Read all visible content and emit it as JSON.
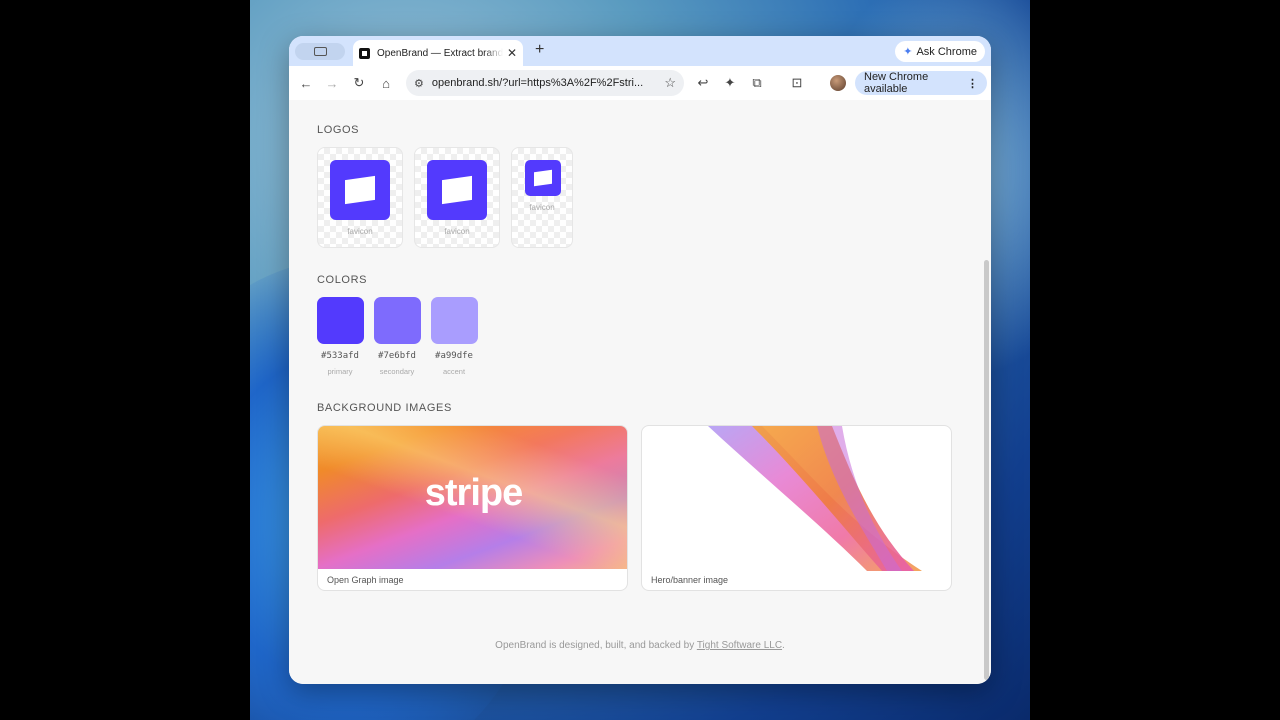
{
  "browser": {
    "tab_title": "OpenBrand — Extract brand assets",
    "new_tab_glyph": "+",
    "ask_chrome_label": "Ask Chrome",
    "url": "openbrand.sh/?url=https%3A%2F%2Fstri...",
    "new_chrome_label": "New Chrome available",
    "nav_icons": [
      "back-icon",
      "forward-icon",
      "reload-icon",
      "home-icon"
    ],
    "toolbar_icons": [
      "reply-icon",
      "extension-puzzle-icon",
      "tab-search-icon",
      "avatar"
    ]
  },
  "logos": {
    "title": "LOGOS",
    "items": [
      {
        "caption": "favicon"
      },
      {
        "caption": "favicon"
      },
      {
        "caption": "favicon"
      }
    ]
  },
  "colors": {
    "title": "COLORS",
    "items": [
      {
        "hex": "#533afd",
        "role": "primary",
        "color": "#533afd"
      },
      {
        "hex": "#7e6bfd",
        "role": "secondary",
        "color": "#7e6bfd"
      },
      {
        "hex": "#a99dfe",
        "role": "accent",
        "color": "#a99dfe"
      }
    ]
  },
  "backgrounds": {
    "title": "BACKGROUND IMAGES",
    "items": [
      {
        "caption": "Open Graph image",
        "overlay_text": "stripe"
      },
      {
        "caption": "Hero/banner image"
      }
    ]
  },
  "footer": {
    "text": "OpenBrand is designed, built, and backed by",
    "link": "Tight Software LLC",
    "end": "."
  }
}
